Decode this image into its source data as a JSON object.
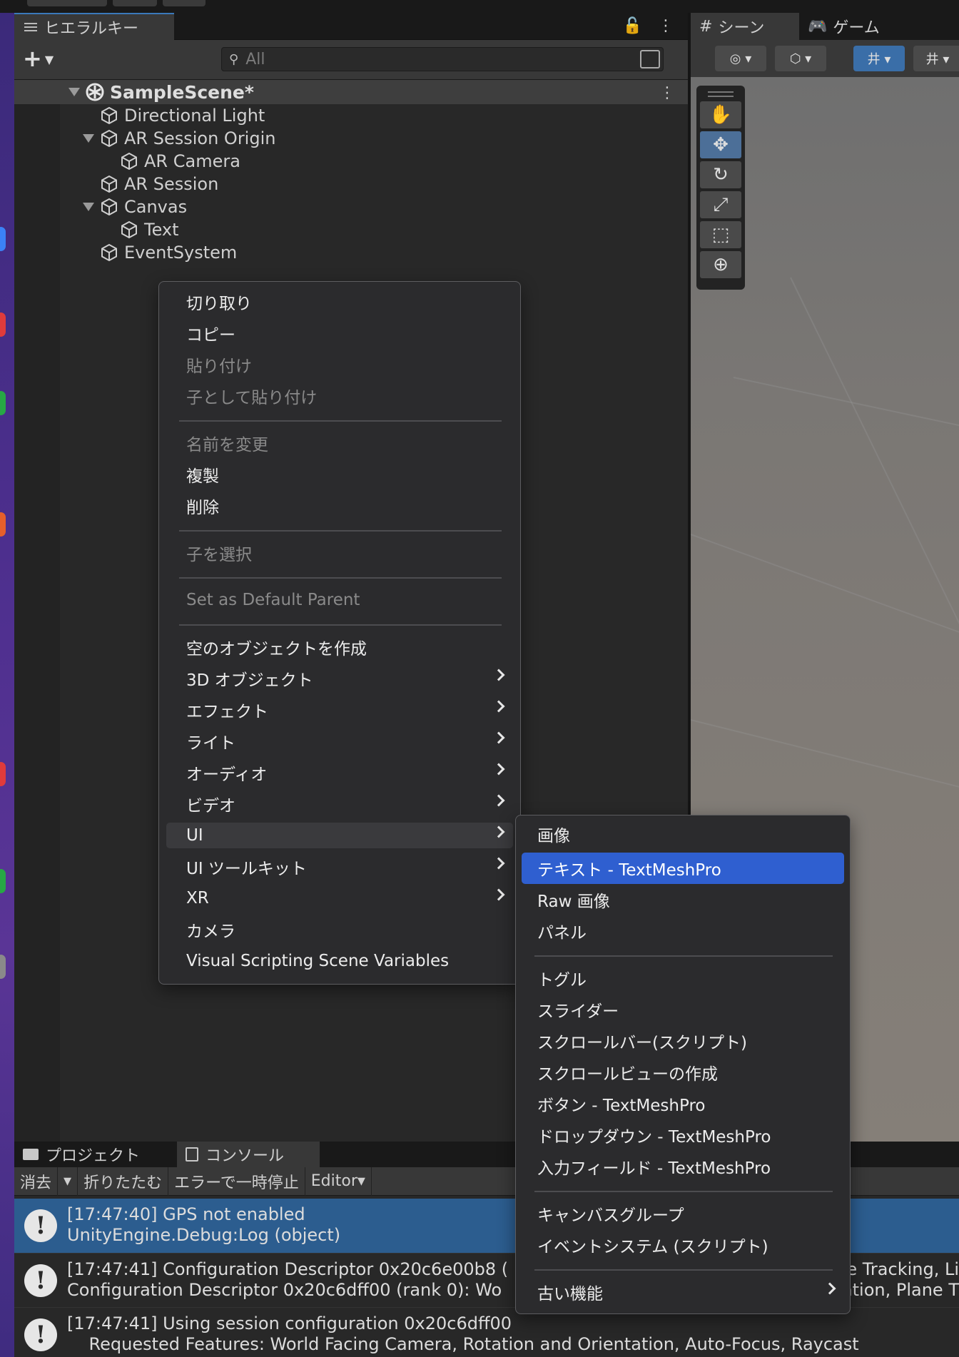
{
  "hierarchy": {
    "tab_label": "ヒエラルキー",
    "search_placeholder": "All",
    "scene_name": "SampleScene*",
    "items": [
      {
        "label": "Directional Light"
      },
      {
        "label": "AR Session Origin"
      },
      {
        "label": "AR Camera"
      },
      {
        "label": "AR Session"
      },
      {
        "label": "Canvas"
      },
      {
        "label": "Text"
      },
      {
        "label": "EventSystem"
      }
    ]
  },
  "scene_panel": {
    "tabs": [
      {
        "label": "シーン"
      },
      {
        "label": "ゲーム"
      }
    ]
  },
  "context_menu": {
    "items": [
      {
        "label": "切り取り",
        "enabled": true
      },
      {
        "label": "コピー",
        "enabled": true
      },
      {
        "label": "貼り付け",
        "enabled": false
      },
      {
        "label": "子として貼り付け",
        "enabled": false
      },
      {
        "label": "名前を変更",
        "enabled": false
      },
      {
        "label": "複製",
        "enabled": true
      },
      {
        "label": "削除",
        "enabled": true
      },
      {
        "label": "子を選択",
        "enabled": false
      },
      {
        "label": "Set as Default Parent",
        "enabled": false
      },
      {
        "label": "空のオブジェクトを作成",
        "enabled": true
      },
      {
        "label": "3D オブジェクト",
        "enabled": true,
        "submenu": true
      },
      {
        "label": "エフェクト",
        "enabled": true,
        "submenu": true
      },
      {
        "label": "ライト",
        "enabled": true,
        "submenu": true
      },
      {
        "label": "オーディオ",
        "enabled": true,
        "submenu": true
      },
      {
        "label": "ビデオ",
        "enabled": true,
        "submenu": true
      },
      {
        "label": "UI",
        "enabled": true,
        "submenu": true,
        "highlighted": true
      },
      {
        "label": "UI ツールキット",
        "enabled": true,
        "submenu": true
      },
      {
        "label": "XR",
        "enabled": true,
        "submenu": true
      },
      {
        "label": "カメラ",
        "enabled": true
      },
      {
        "label": "Visual Scripting Scene Variables",
        "enabled": true
      }
    ]
  },
  "ui_submenu": {
    "items": [
      {
        "label": "画像"
      },
      {
        "label": "テキスト - TextMeshPro",
        "selected": true
      },
      {
        "label": "Raw 画像"
      },
      {
        "label": "パネル"
      },
      {
        "label": "トグル"
      },
      {
        "label": "スライダー"
      },
      {
        "label": "スクロールバー(スクリプト)"
      },
      {
        "label": "スクロールビューの作成"
      },
      {
        "label": "ボタン - TextMeshPro"
      },
      {
        "label": "ドロップダウン - TextMeshPro"
      },
      {
        "label": "入力フィールド - TextMeshPro"
      },
      {
        "label": "キャンバスグループ"
      },
      {
        "label": "イベントシステム (スクリプト)"
      },
      {
        "label": "古い機能",
        "submenu": true
      }
    ]
  },
  "bottom_panel": {
    "tabs": [
      {
        "label": "プロジェクト"
      },
      {
        "label": "コンソール"
      }
    ],
    "toolbar": {
      "clear": "消去",
      "collapse": "折りたたむ",
      "error_pause": "エラーで一時停止",
      "editor": "Editor"
    },
    "logs": [
      {
        "line1": "[17:47:40] GPS not enabled",
        "line2": "UnityEngine.Debug:Log (object)"
      },
      {
        "line1": "[17:47:41] Configuration Descriptor 0x20c6e00b8 (",
        "line1_right": "e Tracking, Li",
        "line2": "Configuration Descriptor 0x20c6dff00 (rank 0): Wo",
        "line2_right": "ation, Plane T"
      },
      {
        "line1": "[17:47:41] Using session configuration 0x20c6dff00",
        "line2": "    Requested Features: World Facing Camera, Rotation and Orientation, Auto-Focus, Raycast"
      }
    ]
  },
  "colors": {
    "menu_bg": "#2b2b2d",
    "selection_blue": "#2f5fd0",
    "console_selected": "#2c5d8f"
  }
}
